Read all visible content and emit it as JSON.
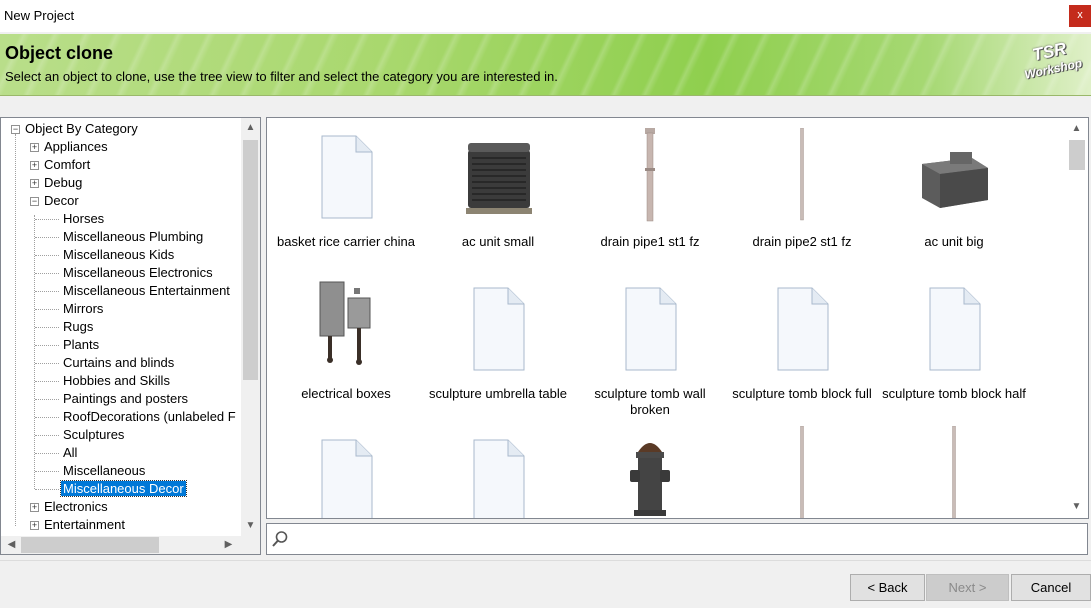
{
  "window": {
    "title": "New Project",
    "close_label": "x"
  },
  "banner": {
    "title": "Object clone",
    "subtitle": "Select an object to clone, use the tree view to filter and select the category you are interested in.",
    "logo_line1": "TSR",
    "logo_line2": "Workshop"
  },
  "tree": {
    "root": "Object By Category",
    "categories": [
      "Appliances",
      "Comfort",
      "Debug",
      "Decor",
      "Electronics",
      "Entertainment"
    ],
    "decor_children": [
      "Horses",
      "Miscellaneous Plumbing",
      "Miscellaneous Kids",
      "Miscellaneous Electronics",
      "Miscellaneous Entertainment",
      "Mirrors",
      "Rugs",
      "Plants",
      "Curtains and blinds",
      "Hobbies and Skills",
      "Paintings and posters",
      "RoofDecorations (unlabeled F",
      "Sculptures",
      "All",
      "Miscellaneous",
      "Miscellaneous Decor"
    ],
    "selected": "Miscellaneous Decor"
  },
  "grid": {
    "items": [
      {
        "caption": "basket rice carrier china",
        "icon": "blank-file-icon"
      },
      {
        "caption": "ac unit small",
        "icon": "ac-unit-small-icon"
      },
      {
        "caption": "drain pipe1 st1 fz",
        "icon": "drain-pipe-icon"
      },
      {
        "caption": "drain pipe2 st1 fz",
        "icon": "drain-pipe-thin-icon"
      },
      {
        "caption": "ac unit big",
        "icon": "ac-unit-big-icon"
      },
      {
        "caption": "electrical boxes",
        "icon": "electrical-boxes-icon"
      },
      {
        "caption": "sculpture umbrella table",
        "icon": "blank-file-icon"
      },
      {
        "caption": "sculpture tomb wall broken",
        "icon": "blank-file-icon"
      },
      {
        "caption": "sculpture tomb block full",
        "icon": "blank-file-icon"
      },
      {
        "caption": "sculpture tomb block half",
        "icon": "blank-file-icon"
      },
      {
        "caption": "",
        "icon": "blank-file-icon"
      },
      {
        "caption": "",
        "icon": "blank-file-icon"
      },
      {
        "caption": "",
        "icon": "fire-hydrant-icon"
      },
      {
        "caption": "",
        "icon": "drain-pipe-thin-icon"
      },
      {
        "caption": "",
        "icon": "drain-pipe-thin-icon"
      }
    ]
  },
  "search": {
    "value": "",
    "icon": "magnifier-icon"
  },
  "buttons": {
    "back": "< Back",
    "next": "Next >",
    "cancel": "Cancel"
  }
}
